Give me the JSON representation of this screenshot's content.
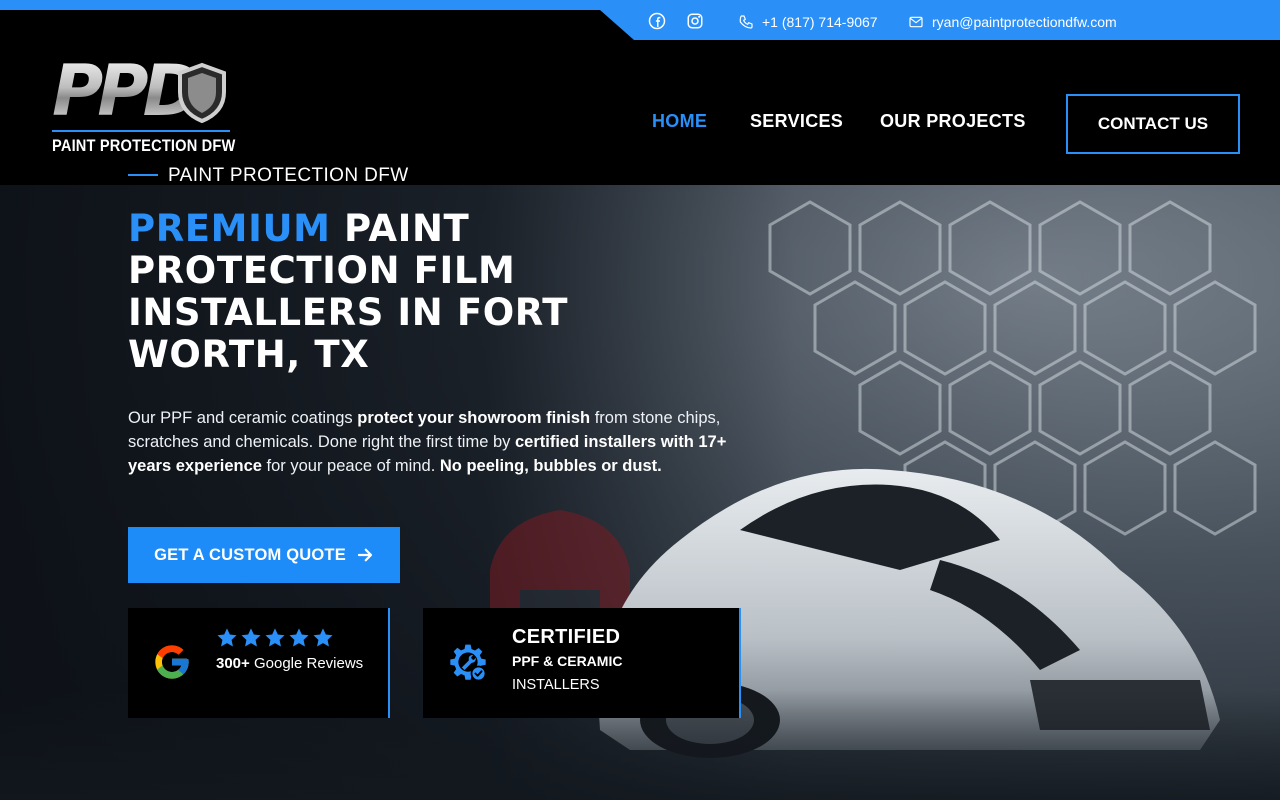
{
  "colors": {
    "accent": "#2a8ff7",
    "header_bg": "#000000",
    "star": "#2a8ff7"
  },
  "topbar": {
    "social": [
      {
        "icon": "facebook-icon"
      },
      {
        "icon": "instagram-icon"
      }
    ],
    "phone": "+1 (817) 714-9067",
    "email": "ryan@paintprotectiondfw.com"
  },
  "logo": {
    "letters": "PPD",
    "tagline": "PAINT PROTECTION DFW"
  },
  "nav": {
    "items": [
      {
        "label": "HOME",
        "active": true
      },
      {
        "label": "SERVICES"
      },
      {
        "label": "OUR PROJECTS"
      }
    ],
    "contact_label": "CONTACT US"
  },
  "hero": {
    "eyebrow": "PAINT PROTECTION DFW",
    "headline_accent": "PREMIUM",
    "headline_rest": " PAINT PROTECTION FILM INSTALLERS IN FORT WORTH, TX",
    "body": [
      {
        "text": "Our PPF and ceramic coatings ",
        "bold": false
      },
      {
        "text": "protect your showroom finish",
        "bold": true
      },
      {
        "text": " from stone chips, scratches and chemicals. Done right the first time by ",
        "bold": false
      },
      {
        "text": "certified installers with 17+ years experience",
        "bold": true
      },
      {
        "text": " for your peace of mind. ",
        "bold": false
      },
      {
        "text": "No peeling, bubbles or dust.",
        "bold": true
      }
    ],
    "cta_label": "GET A CUSTOM QUOTE"
  },
  "badges": {
    "reviews": {
      "stars": 5,
      "count": "300+",
      "text": " Google Reviews"
    },
    "certified": {
      "title": "CERTIFIED",
      "line1": "PPF & CERAMIC",
      "line2": "INSTALLERS"
    }
  }
}
